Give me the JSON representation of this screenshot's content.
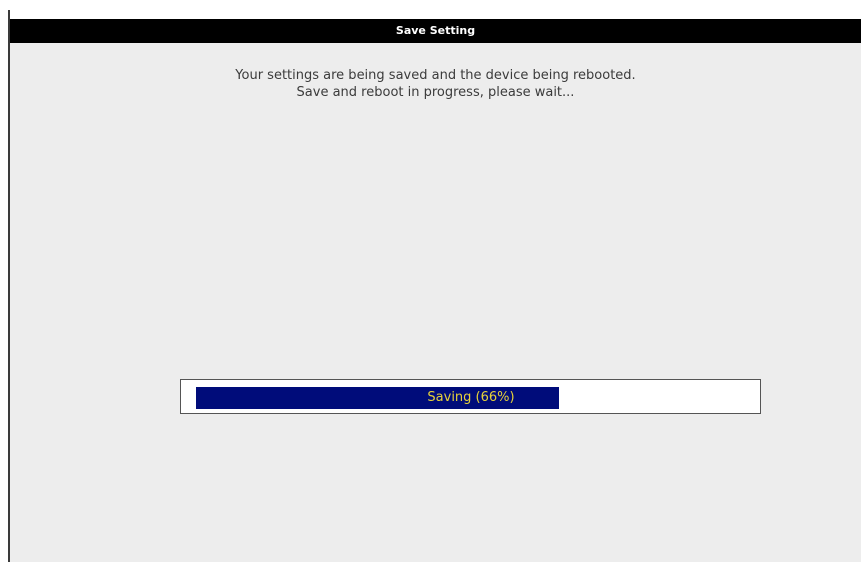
{
  "dialog": {
    "title": "Save Setting",
    "message_line1": "Your settings are being saved and the device being rebooted.",
    "message_line2": "Save and reboot in progress, please wait..."
  },
  "progress": {
    "label": "Saving (66%)",
    "percent": 66,
    "fill_color": "#000c7a",
    "label_color": "#e6d23a"
  },
  "colors": {
    "title_bar_bg": "#000000",
    "title_text": "#ffffff",
    "dialog_bg": "#ededed"
  }
}
